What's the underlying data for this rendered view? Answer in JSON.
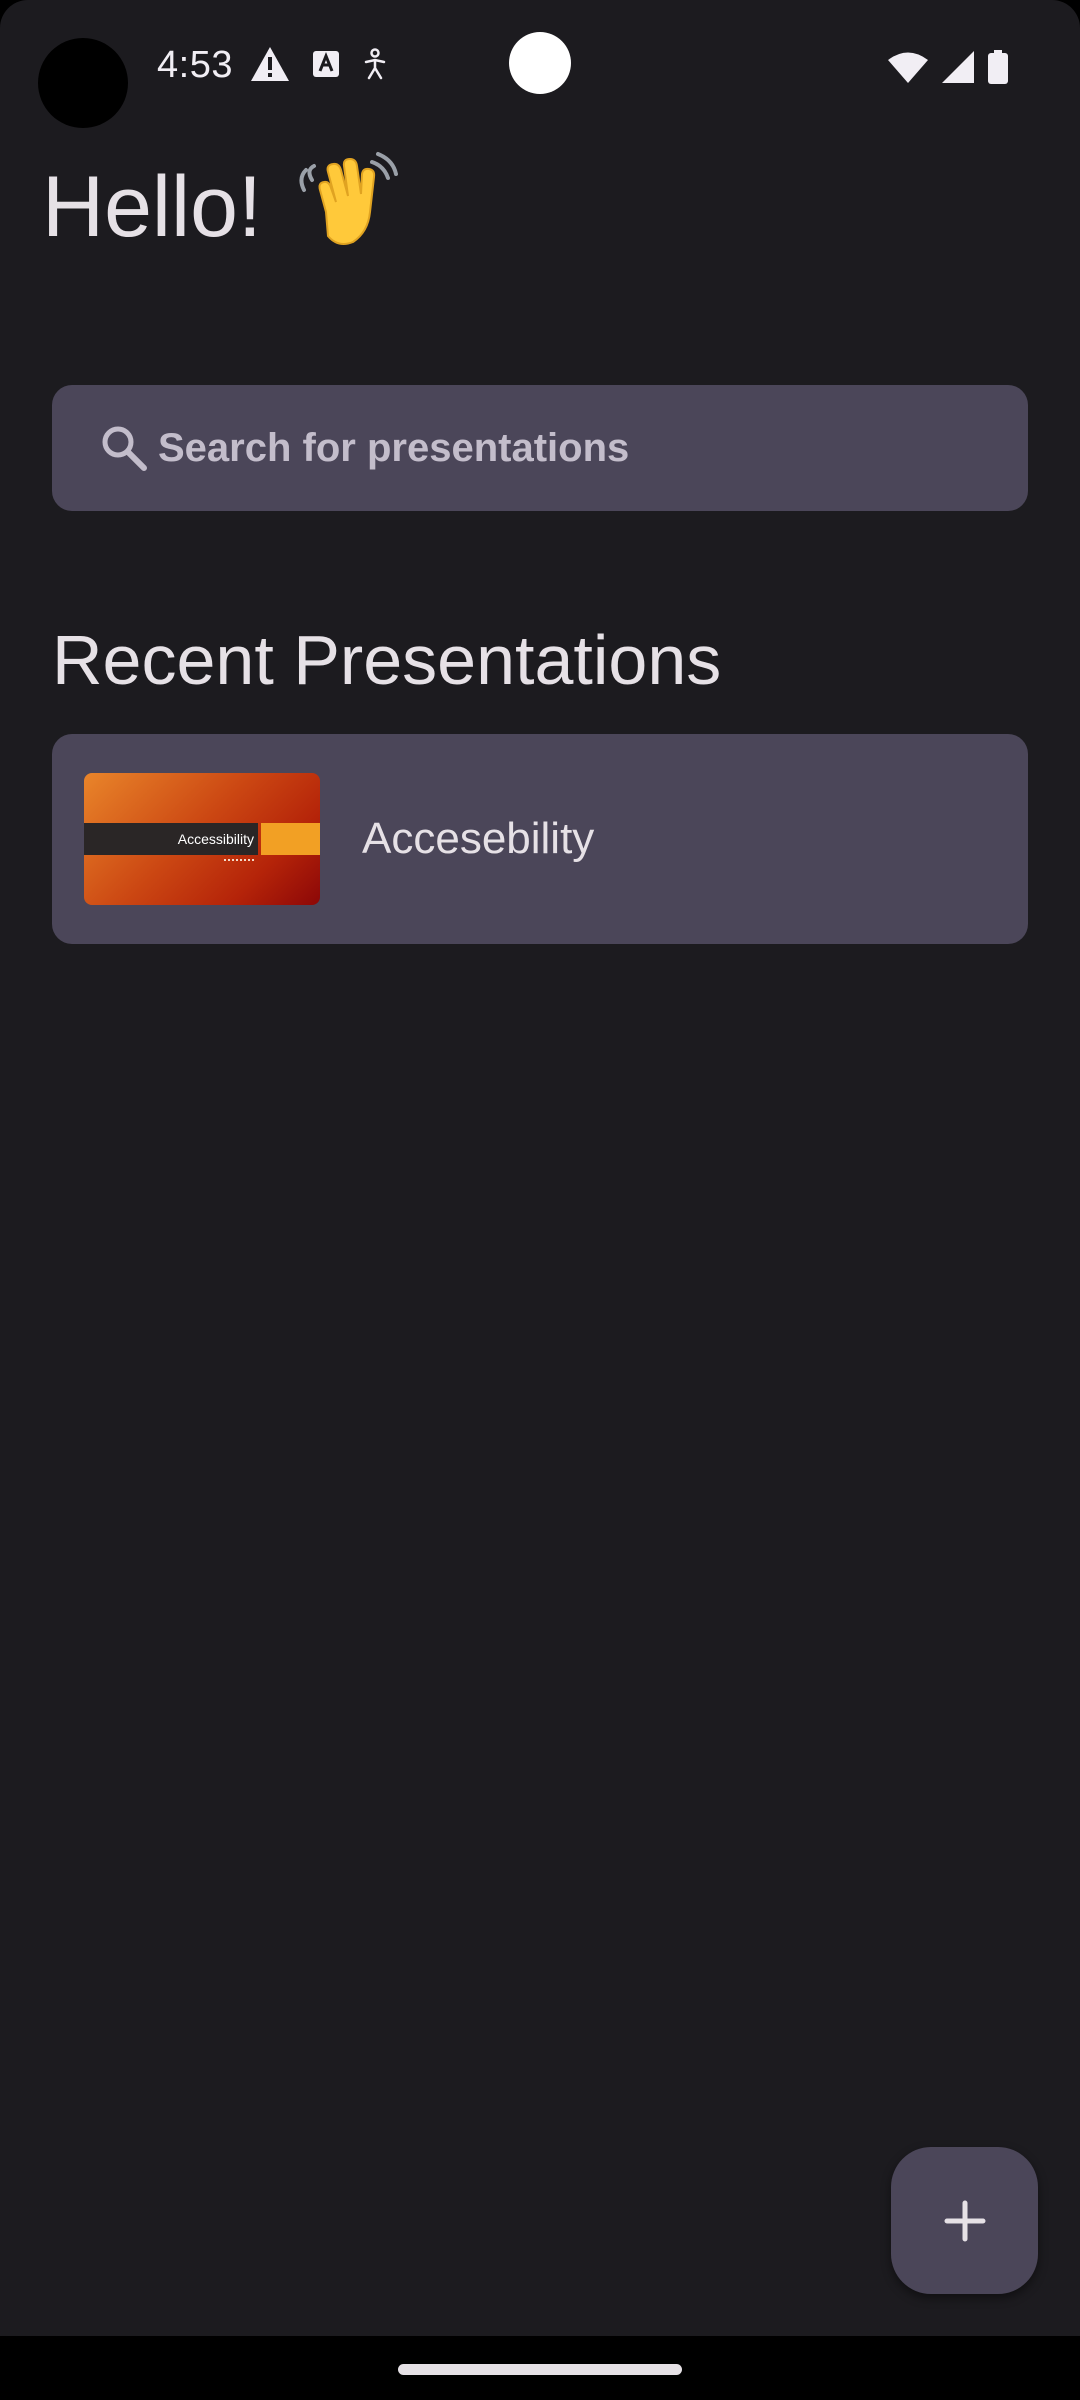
{
  "status_bar": {
    "time": "4:53",
    "left_icons": [
      "warning-icon",
      "text-a-icon",
      "accessibility-icon"
    ],
    "right_icons": [
      "wifi-icon",
      "signal-icon",
      "battery-icon"
    ]
  },
  "greeting": {
    "text": "Hello!",
    "emoji_icon": "waving-hand-icon"
  },
  "search": {
    "placeholder": "Search for presentations",
    "icon": "search-icon"
  },
  "recent": {
    "title": "Recent Presentations",
    "items": [
      {
        "title": "Accesebility",
        "thumbnail_title": "Accessibility"
      }
    ]
  },
  "fab": {
    "icon": "plus-icon"
  },
  "colors": {
    "background": "#1c1b1f",
    "surface": "#4b4659",
    "text": "#e6e1e6",
    "placeholder": "#c3bdcb"
  }
}
